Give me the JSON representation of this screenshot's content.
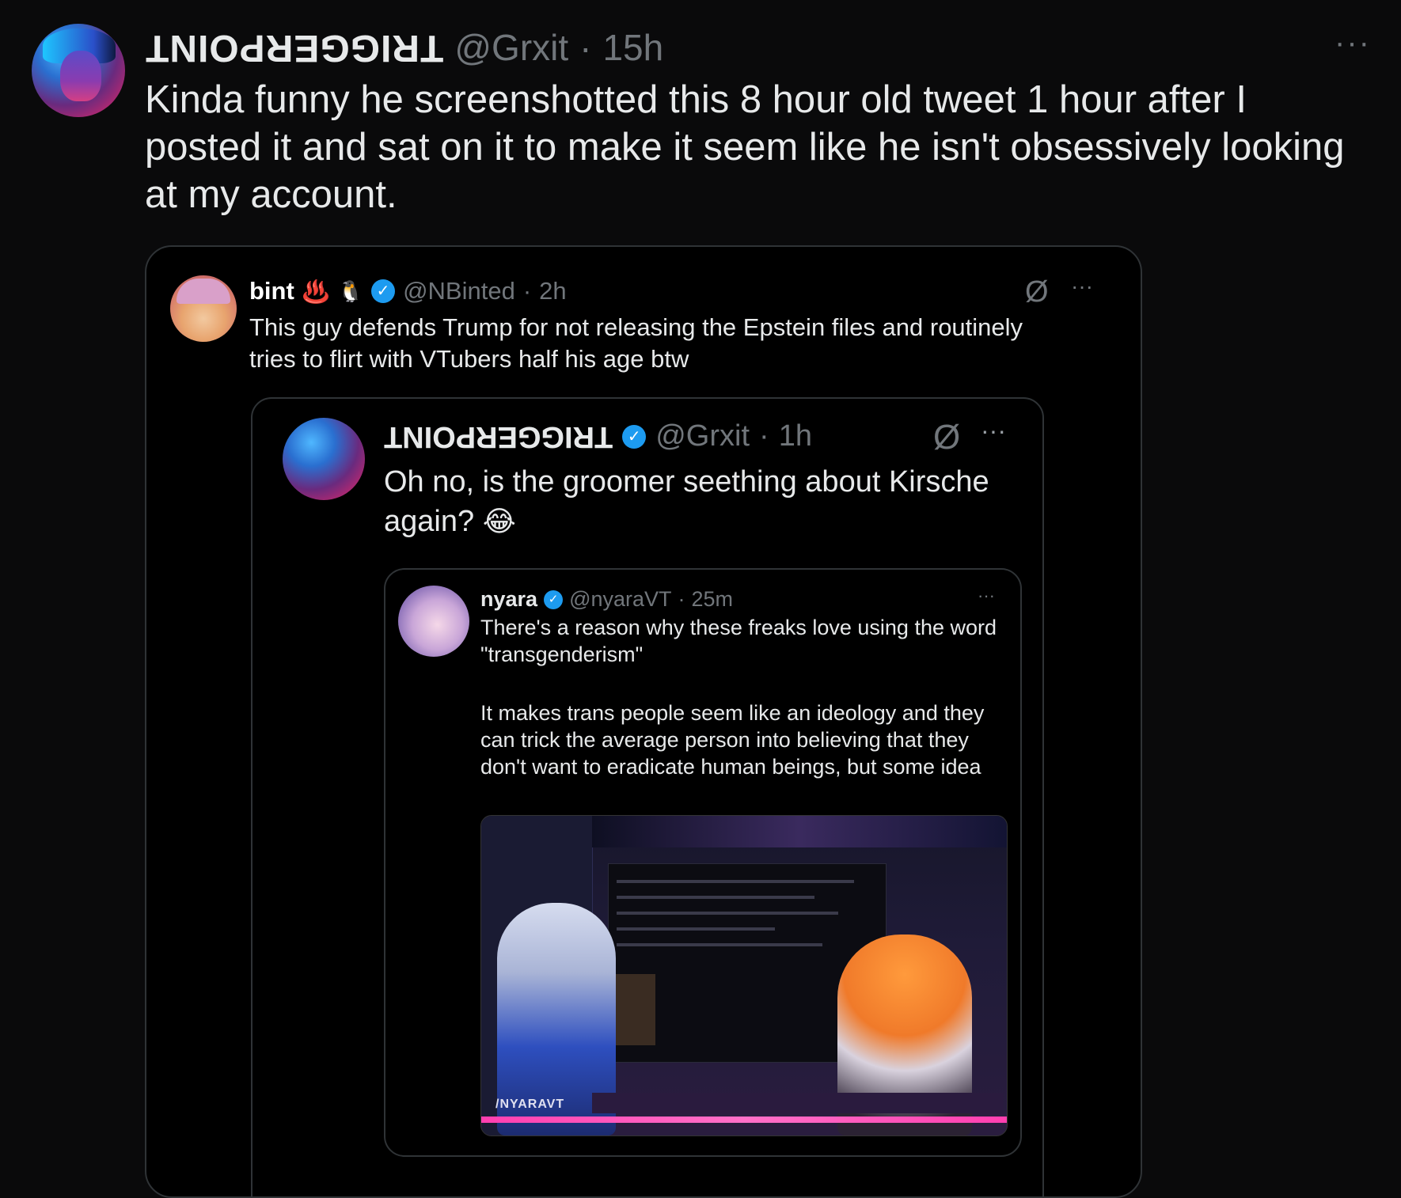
{
  "tweet": {
    "author_name": "TRIGGERPOINT",
    "handle": "@Grxit",
    "separator": "·",
    "time": "15h",
    "more_label": "···",
    "text": "Kinda funny he screenshotted this 8 hour old tweet 1 hour after I posted it and sat on it to make it seem like he isn't obsessively looking at my account."
  },
  "screenshot": {
    "bint": {
      "name": "bint",
      "emoji1": "♨️",
      "emoji2": "🐧",
      "verified_glyph": "✓",
      "handle": "@NBinted",
      "separator": "·",
      "time": "2h",
      "grok_icon": "Ø",
      "more_label": "···",
      "text": "This guy defends Trump for not releasing the Epstein files and routinely tries to flirt with VTubers half his age btw"
    },
    "grxit": {
      "name": "TRIGGERPOINT",
      "verified_glyph": "✓",
      "handle": "@Grxit",
      "separator": "·",
      "time": "1h",
      "grok_icon": "Ø",
      "more_label": "···",
      "text": "Oh no, is the groomer seething about Kirsche again?",
      "emoji": "😂"
    },
    "nyara": {
      "name": "nyara",
      "verified_glyph": "✓",
      "handle": "@nyaraVT",
      "separator": "·",
      "time": "25m",
      "more_label": "···",
      "text1": "There's a reason why these freaks love using the word \"transgenderism\"",
      "text2": "It makes trans people seem like an ideology and they can trick the average person into believing that they don't want to eradicate human beings, but some idea",
      "image_watermark": "/NYARAVT"
    }
  },
  "colors": {
    "background": "#0a0a0b",
    "text": "#e7e9ea",
    "muted": "#71767b",
    "verified": "#1d9bf0",
    "border": "#2f3336"
  }
}
